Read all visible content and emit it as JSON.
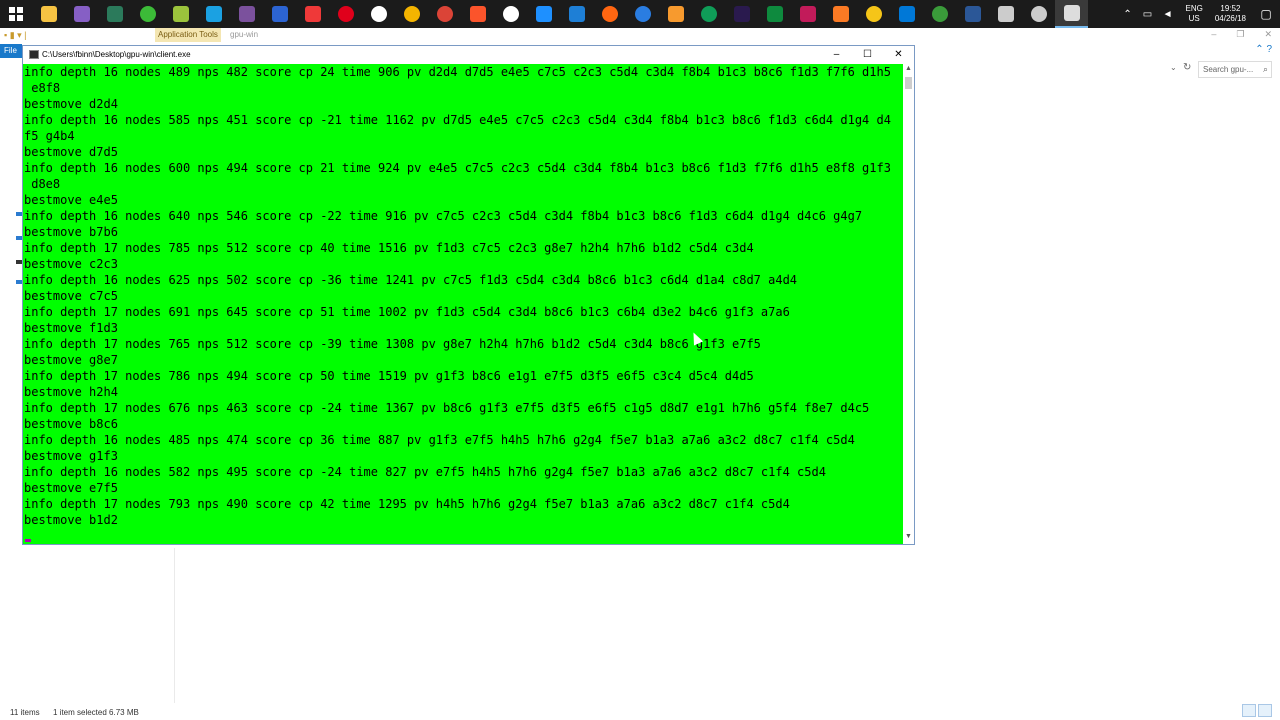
{
  "taskbar": {
    "icons": [
      {
        "name": "file-explorer-icon",
        "color": "#f6c343"
      },
      {
        "name": "visual-studio-icon",
        "color": "#865fc5"
      },
      {
        "name": "app-green-icon",
        "color": "#2b7a5b"
      },
      {
        "name": "yandex-green-icon",
        "color": "#3cbb38"
      },
      {
        "name": "android-icon",
        "color": "#9bc33c"
      },
      {
        "name": "skype-icon",
        "color": "#1ba1e2"
      },
      {
        "name": "viber-icon",
        "color": "#7b519d"
      },
      {
        "name": "messenger-icon",
        "color": "#2c64d2"
      },
      {
        "name": "vivaldi-icon",
        "color": "#ef3939"
      },
      {
        "name": "opera-icon",
        "color": "#e0001b"
      },
      {
        "name": "opera-dev-icon",
        "color": "#ffffff"
      },
      {
        "name": "chrome-canary-icon",
        "color": "#f4b400"
      },
      {
        "name": "chrome-icon",
        "color": "#db4437"
      },
      {
        "name": "brave-icon",
        "color": "#fb542b"
      },
      {
        "name": "yandex-browser-icon",
        "color": "#ffffff"
      },
      {
        "name": "edge-icon",
        "color": "#1e90ff"
      },
      {
        "name": "ie-icon",
        "color": "#1e7fd6"
      },
      {
        "name": "firefox-icon",
        "color": "#ff6611"
      },
      {
        "name": "firefox-dev-icon",
        "color": "#2a7de1"
      },
      {
        "name": "paint-icon",
        "color": "#f79a2e"
      },
      {
        "name": "chrome-beta-icon",
        "color": "#0f9d58"
      },
      {
        "name": "photoshop-icon",
        "color": "#2a1a4e"
      },
      {
        "name": "visual-studio-code-icon",
        "color": "#0e8a3e"
      },
      {
        "name": "jetbrains-icon",
        "color": "#c21b5a"
      },
      {
        "name": "xampp-icon",
        "color": "#fb7a24"
      },
      {
        "name": "chrome-dev-icon",
        "color": "#f5c518"
      },
      {
        "name": "remote-desktop-icon",
        "color": "#0078d7"
      },
      {
        "name": "green-globe-icon",
        "color": "#3a9b3a"
      },
      {
        "name": "document-icon",
        "color": "#2b5797"
      },
      {
        "name": "device-icon",
        "color": "#cccccc"
      },
      {
        "name": "settings-ring-icon",
        "color": "#cccccc"
      },
      {
        "name": "console-app-icon",
        "color": "#dddddd"
      }
    ],
    "tray": {
      "lang_line1": "ENG",
      "lang_line2": "US",
      "time": "19:52",
      "date": "04/26/18"
    }
  },
  "explorer": {
    "application_tools_label": "Application Tools",
    "title": "gpu-win",
    "file_tab": "File",
    "search_placeholder": "Search gpu-...",
    "status_items": "11 items",
    "status_selected": "1 item selected  6.73 MB"
  },
  "console": {
    "title": "C:\\Users\\fbinn\\Desktop\\gpu-win\\client.exe",
    "lines": [
      "info depth 16 nodes 489 nps 482 score cp 24 time 906 pv d2d4 d7d5 e4e5 c7c5 c2c3 c5d4 c3d4 f8b4 b1c3 b8c6 f1d3 f7f6 d1h5",
      " e8f8",
      "bestmove d2d4",
      "info depth 16 nodes 585 nps 451 score cp -21 time 1162 pv d7d5 e4e5 c7c5 c2c3 c5d4 c3d4 f8b4 b1c3 b8c6 f1d3 c6d4 d1g4 d4",
      "f5 g4b4",
      "bestmove d7d5",
      "info depth 16 nodes 600 nps 494 score cp 21 time 924 pv e4e5 c7c5 c2c3 c5d4 c3d4 f8b4 b1c3 b8c6 f1d3 f7f6 d1h5 e8f8 g1f3",
      " d8e8",
      "bestmove e4e5",
      "info depth 16 nodes 640 nps 546 score cp -22 time 916 pv c7c5 c2c3 c5d4 c3d4 f8b4 b1c3 b8c6 f1d3 c6d4 d1g4 d4c6 g4g7",
      "bestmove b7b6",
      "info depth 17 nodes 785 nps 512 score cp 40 time 1516 pv f1d3 c7c5 c2c3 g8e7 h2h4 h7h6 b1d2 c5d4 c3d4",
      "bestmove c2c3",
      "info depth 16 nodes 625 nps 502 score cp -36 time 1241 pv c7c5 f1d3 c5d4 c3d4 b8c6 b1c3 c6d4 d1a4 c8d7 a4d4",
      "bestmove c7c5",
      "info depth 17 nodes 691 nps 645 score cp 51 time 1002 pv f1d3 c5d4 c3d4 b8c6 b1c3 c6b4 d3e2 b4c6 g1f3 a7a6",
      "bestmove f1d3",
      "info depth 17 nodes 765 nps 512 score cp -39 time 1308 pv g8e7 h2h4 h7h6 b1d2 c5d4 c3d4 b8c6 g1f3 e7f5",
      "bestmove g8e7",
      "info depth 17 nodes 786 nps 494 score cp 50 time 1519 pv g1f3 b8c6 e1g1 e7f5 d3f5 e6f5 c3c4 d5c4 d4d5",
      "bestmove h2h4",
      "info depth 17 nodes 676 nps 463 score cp -24 time 1367 pv b8c6 g1f3 e7f5 d3f5 e6f5 c1g5 d8d7 e1g1 h7h6 g5f4 f8e7 d4c5",
      "bestmove b8c6",
      "info depth 16 nodes 485 nps 474 score cp 36 time 887 pv g1f3 e7f5 h4h5 h7h6 g2g4 f5e7 b1a3 a7a6 a3c2 d8c7 c1f4 c5d4",
      "bestmove g1f3",
      "info depth 16 nodes 582 nps 495 score cp -24 time 827 pv e7f5 h4h5 h7h6 g2g4 f5e7 b1a3 a7a6 a3c2 d8c7 c1f4 c5d4",
      "bestmove e7f5",
      "info depth 17 nodes 793 nps 490 score cp 42 time 1295 pv h4h5 h7h6 g2g4 f5e7 b1a3 a7a6 a3c2 d8c7 c1f4 c5d4",
      "bestmove b1d2"
    ]
  }
}
